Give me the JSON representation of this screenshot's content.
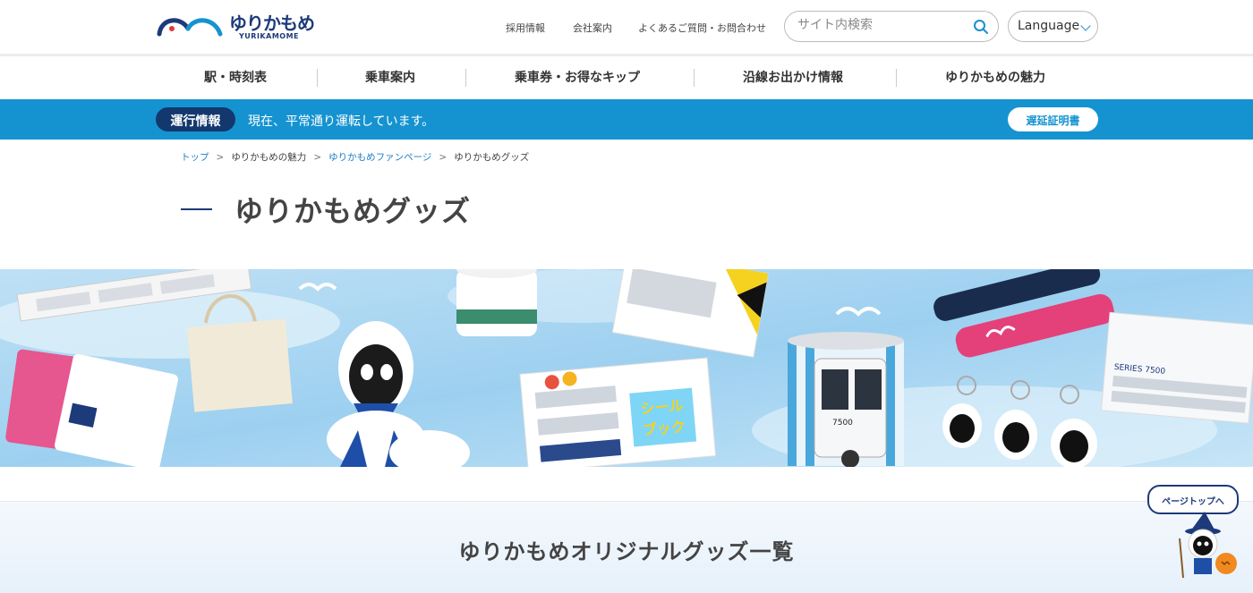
{
  "header": {
    "logo_text": "ゆりかもめ",
    "logo_sub": "YURIKAMOME",
    "links": [
      "採用情報",
      "会社案内",
      "よくあるご質問・お問合わせ"
    ],
    "search_placeholder": "サイト内検索",
    "language_label": "Language"
  },
  "gnav": {
    "items": [
      "駅・時刻表",
      "乗車案内",
      "乗車券・お得なキップ",
      "沿線お出かけ情報",
      "ゆりかもめの魅力"
    ]
  },
  "status": {
    "tag": "運行情報",
    "message": "現在、平常通り運転しています。",
    "delay_button": "遅延証明書"
  },
  "breadcrumb": [
    "トップ",
    "ゆりかもめの魅力",
    "ゆりかもめファンページ",
    "ゆりかもめグッズ"
  ],
  "page_title": "ゆりかもめグッズ",
  "hero": {
    "book_title_1": "シール",
    "book_title_2": "ブック",
    "train_label": "7500",
    "train_label_2": "SERIES 7500"
  },
  "section_title": "ゆりかもめオリジナルグッズ一覧",
  "pagetop_label": "ページトップへ",
  "colors": {
    "brand_navy": "#1d3a7a",
    "accent_blue": "#1593d1",
    "link_blue": "#1f7ec4"
  }
}
